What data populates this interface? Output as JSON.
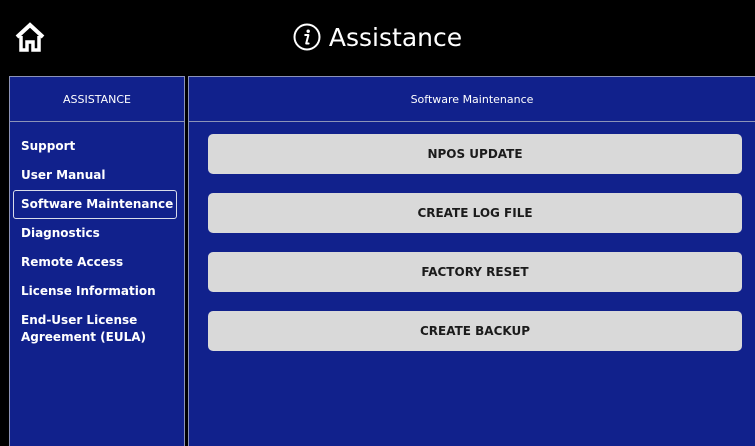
{
  "header": {
    "title": "Assistance",
    "home_icon": "home-icon",
    "info_icon": "info-icon"
  },
  "sidebar": {
    "title": "ASSISTANCE",
    "selected": "Software Maintenance",
    "items": [
      {
        "label": "Support"
      },
      {
        "label": "User Manual"
      },
      {
        "label": "Software Maintenance"
      },
      {
        "label": "Diagnostics"
      },
      {
        "label": "Remote Access"
      },
      {
        "label": "License Information"
      },
      {
        "label": "End-User License Agreement (EULA)"
      }
    ]
  },
  "main": {
    "title": "Software Maintenance",
    "buttons": [
      {
        "label": "NPOS UPDATE"
      },
      {
        "label": "CREATE LOG FILE"
      },
      {
        "label": "FACTORY RESET"
      },
      {
        "label": "CREATE BACKUP"
      }
    ]
  },
  "colors": {
    "background": "#000000",
    "panel": "#11218c",
    "panel_border": "#8c93b8",
    "button": "#d9d9d9",
    "button_text": "#1b1b1b"
  }
}
